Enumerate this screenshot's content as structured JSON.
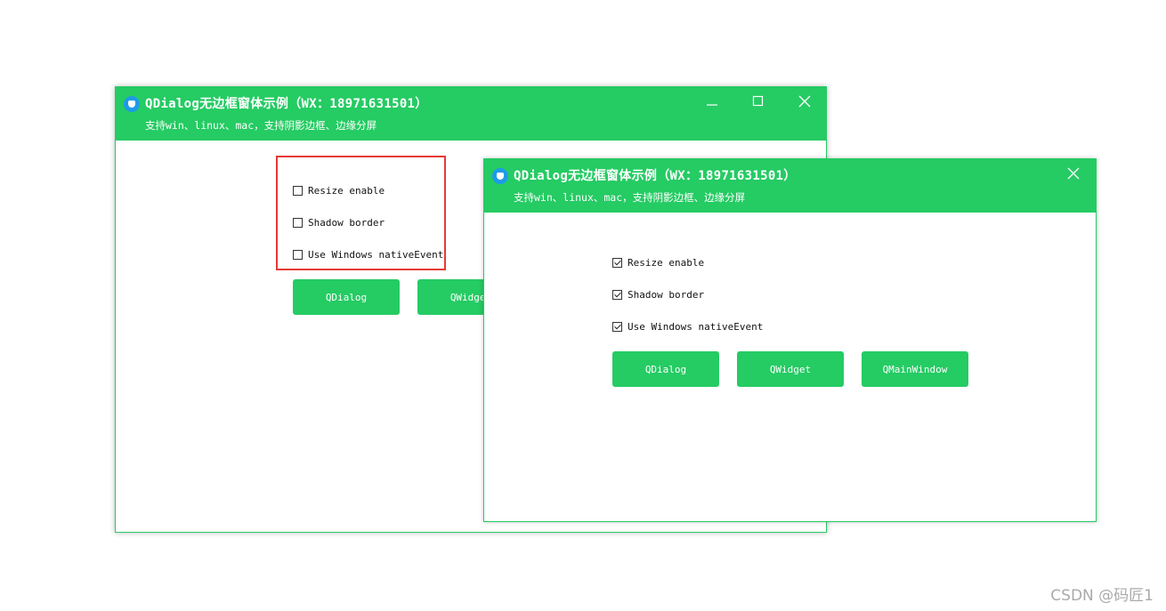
{
  "colors": {
    "accent": "#25cb63",
    "highlight_border": "#e53935",
    "logo": "#1e9be6"
  },
  "window_back": {
    "title": "QDialog无边框窗体示例（WX：18971631501）",
    "subtitle": "支持win、linux、mac，支持阴影边框、边缘分屏",
    "controls": [
      "minimize-icon",
      "maximize-icon",
      "close-icon"
    ],
    "options": [
      {
        "label": "Resize enable",
        "checked": false
      },
      {
        "label": "Shadow border",
        "checked": false
      },
      {
        "label": "Use Windows nativeEvent",
        "checked": false
      }
    ],
    "buttons": [
      "QDialog",
      "QWidget"
    ]
  },
  "window_front": {
    "title": "QDialog无边框窗体示例（WX：18971631501）",
    "subtitle": "支持win、linux、mac，支持阴影边框、边缘分屏",
    "controls": [
      "close-icon"
    ],
    "options": [
      {
        "label": "Resize enable",
        "checked": true
      },
      {
        "label": "Shadow border",
        "checked": true
      },
      {
        "label": "Use Windows nativeEvent",
        "checked": true
      }
    ],
    "buttons": [
      "QDialog",
      "QWidget",
      "QMainWindow"
    ]
  },
  "watermark": "CSDN @码匠1"
}
